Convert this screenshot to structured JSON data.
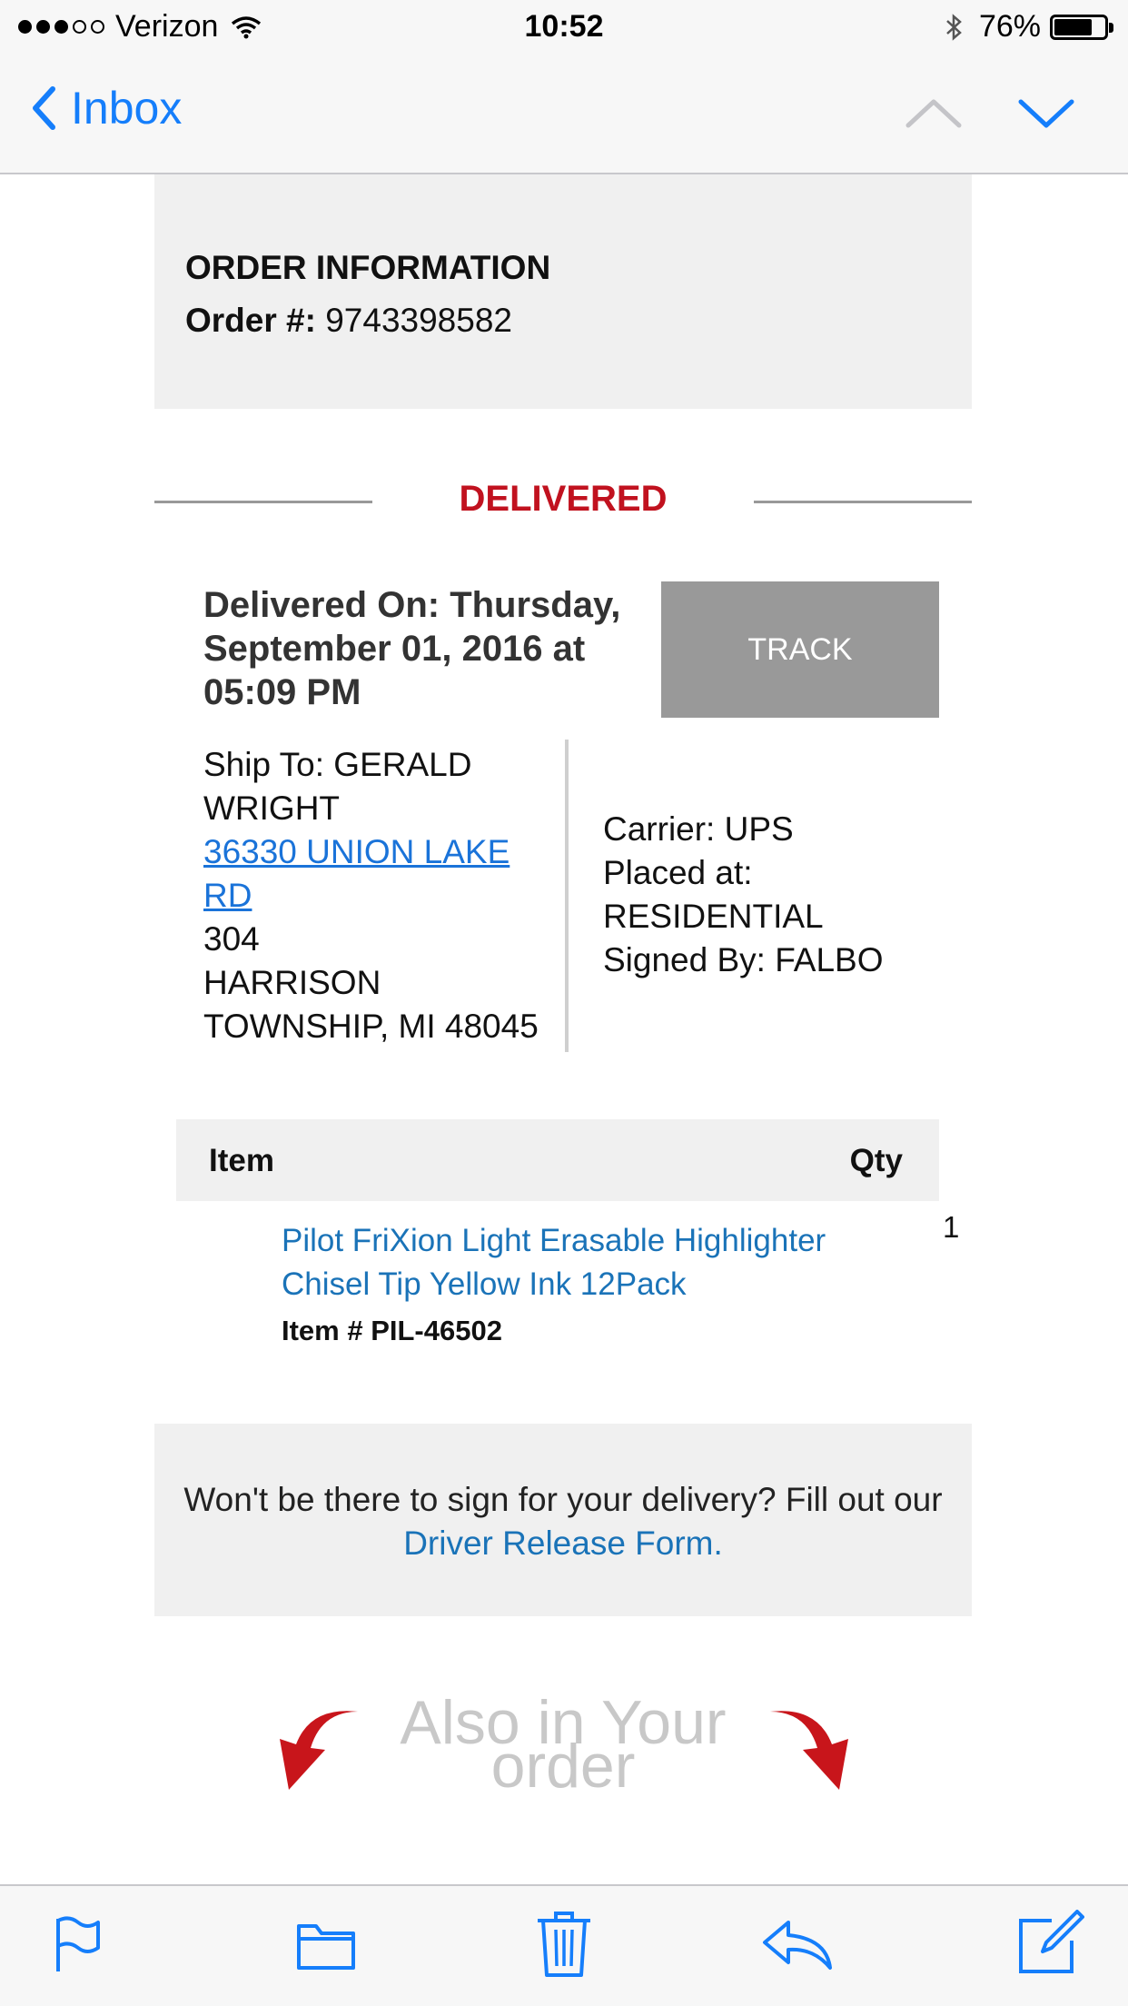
{
  "status_bar": {
    "carrier": "Verizon",
    "time": "10:52",
    "battery": "76%",
    "battery_level": 0.76,
    "signal_bars_filled": 3,
    "signal_bars_total": 5
  },
  "nav": {
    "back_label": "Inbox"
  },
  "email": {
    "order_section_title": "ORDER INFORMATION",
    "order_number_label": "Order #:",
    "order_number": "9743398582",
    "status": "DELIVERED",
    "delivered_on": "Delivered On: Thursday, September 01, 2016 at 05:09 PM",
    "track_label": "TRACK",
    "ship_to_label": "Ship To: GERALD WRIGHT",
    "address_line1": "36330 UNION LAKE RD",
    "address_line2": "304",
    "address_line3": "HARRISON TOWNSHIP, MI 48045",
    "carrier": "Carrier: UPS",
    "placed_at": "Placed at: RESIDENTIAL",
    "signed_by": "Signed By: FALBO",
    "table": {
      "col_item": "Item",
      "col_qty": "Qty",
      "rows": [
        {
          "name": "Pilot FriXion Light Erasable Highlighter Chisel Tip Yellow Ink 12Pack",
          "sku": "Item # PIL-46502",
          "qty": "1"
        }
      ]
    },
    "release_text": "Won't be there to sign for your delivery? Fill out our",
    "release_link": "Driver Release Form.",
    "also_line1": "Also in Your",
    "also_line2": "order"
  },
  "colors": {
    "ios_blue": "#157efb",
    "status_red": "#c1121f",
    "link_blue": "#1a73b8",
    "track_gray": "#999999"
  },
  "toolbar": {
    "icons": [
      "flag-icon",
      "folder-icon",
      "trash-icon",
      "reply-icon",
      "compose-icon"
    ]
  }
}
